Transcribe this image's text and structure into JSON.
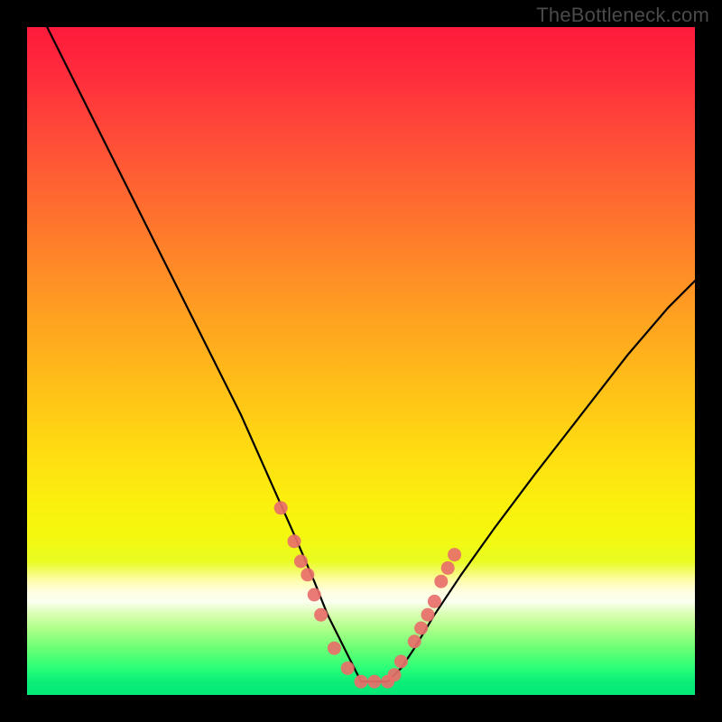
{
  "watermark": "TheBottleneck.com",
  "chart_data": {
    "type": "line",
    "title": "",
    "xlabel": "",
    "ylabel": "",
    "xlim": [
      0,
      100
    ],
    "ylim": [
      0,
      100
    ],
    "grid": false,
    "legend": false,
    "series": [
      {
        "name": "curve",
        "x": [
          3,
          8,
          14,
          20,
          26,
          32,
          36,
          40,
          43,
          45,
          47,
          49,
          50,
          52,
          54,
          56,
          58,
          61,
          65,
          70,
          76,
          83,
          90,
          96,
          100
        ],
        "y": [
          100,
          90,
          78,
          66,
          54,
          42,
          33,
          24,
          17,
          12,
          8,
          4,
          2,
          2,
          2,
          4,
          7,
          12,
          18,
          25,
          33,
          42,
          51,
          58,
          62
        ]
      }
    ],
    "markers": {
      "name": "cluster-points",
      "comment": "Salmon dot cluster near the valley of the curve",
      "x": [
        38,
        40,
        41,
        42,
        43,
        44,
        46,
        48,
        50,
        52,
        54,
        55,
        56,
        58,
        59,
        60,
        61,
        62,
        63,
        64
      ],
      "y": [
        28,
        23,
        20,
        18,
        15,
        12,
        7,
        4,
        2,
        2,
        2,
        3,
        5,
        8,
        10,
        12,
        14,
        17,
        19,
        21
      ]
    },
    "background_gradient": {
      "direction": "vertical",
      "stops": [
        {
          "pos": 0.0,
          "color": "#ff1a3c"
        },
        {
          "pos": 0.35,
          "color": "#ff8728"
        },
        {
          "pos": 0.7,
          "color": "#fced0e"
        },
        {
          "pos": 0.85,
          "color": "#fffde0"
        },
        {
          "pos": 1.0,
          "color": "#05e877"
        }
      ]
    }
  }
}
